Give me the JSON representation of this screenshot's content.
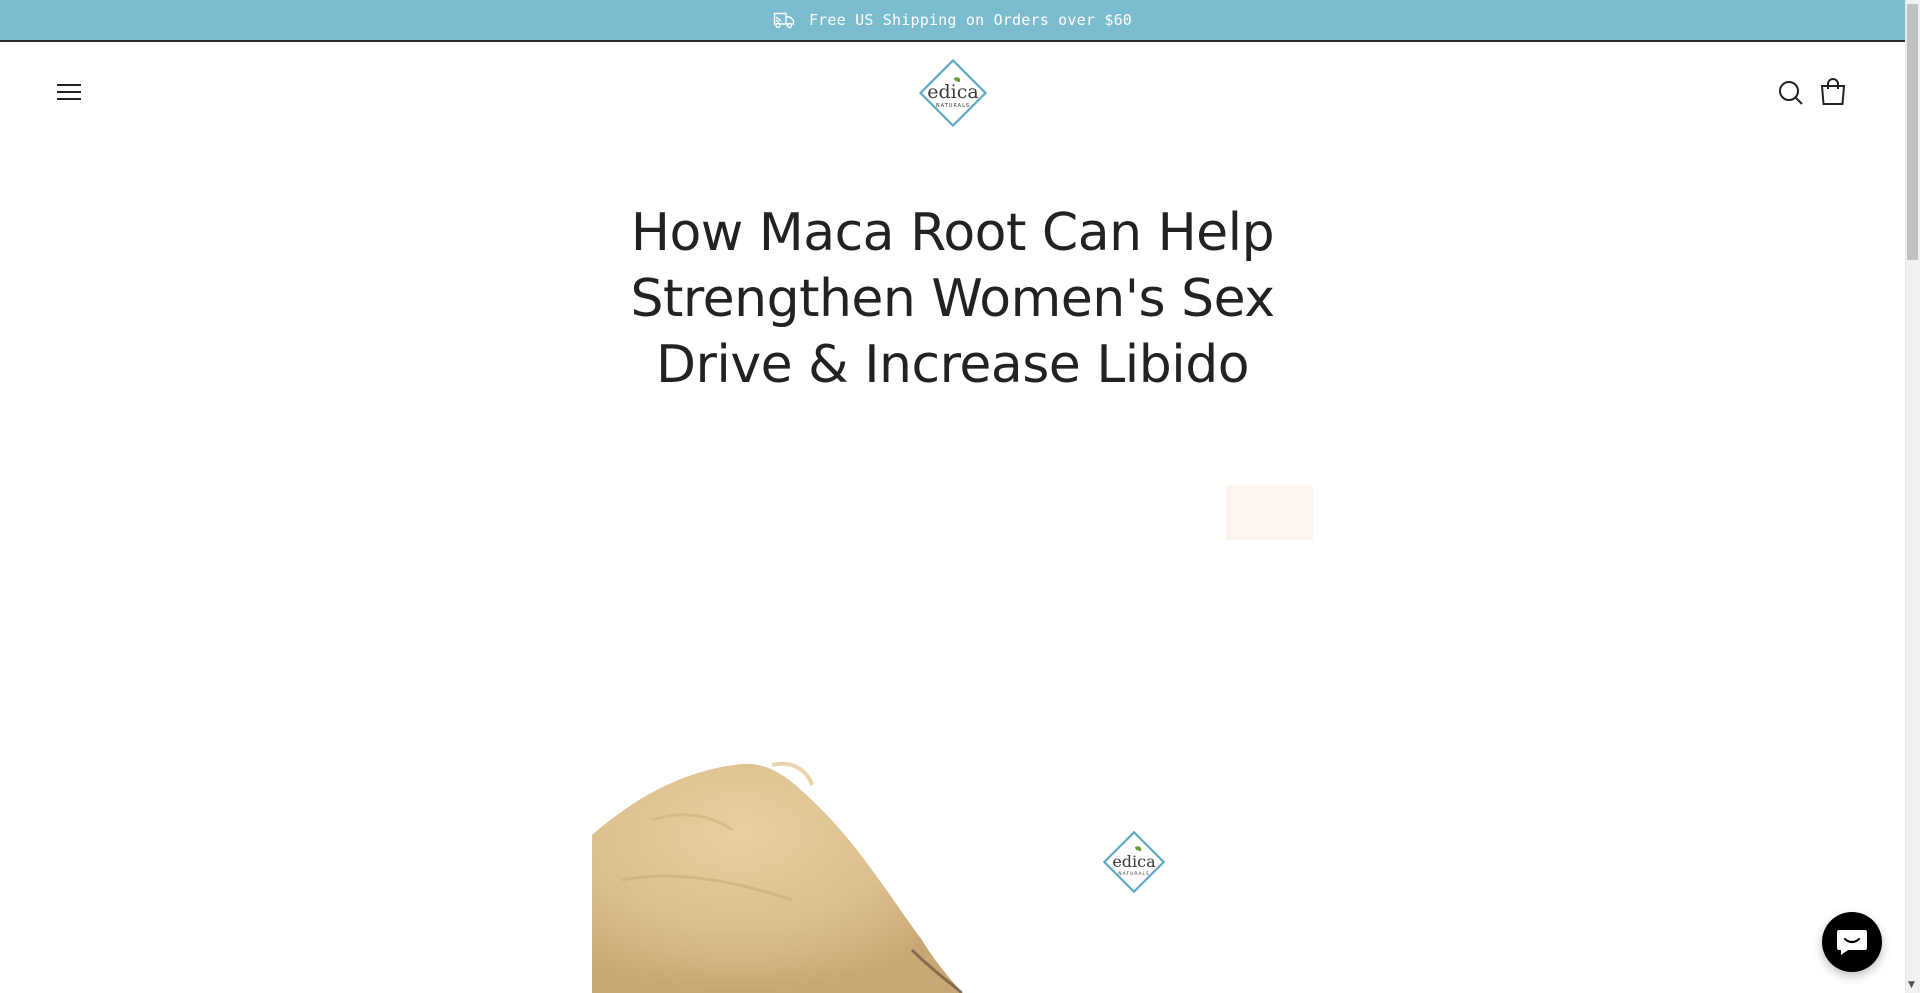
{
  "announcement": {
    "text": "Free US Shipping on Orders over $60",
    "icon": "truck-icon",
    "background": "#7cbcd0"
  },
  "header": {
    "menu_icon": "hamburger-menu-icon",
    "logo": {
      "wordmark": "edica",
      "tagline": "NATURALS",
      "border_color": "#5fa9c5",
      "leaf_color": "#6a9a3a"
    },
    "search_icon": "search-icon",
    "cart_icon": "shopping-bag-icon"
  },
  "article": {
    "title": "How Maca Root Can Help Strengthen Women's Sex Drive & Increase Libido"
  },
  "hero_image": {
    "subject": "maca powder mound with brand logo",
    "powder_color": "#dcbf8e"
  },
  "chat": {
    "icon": "chat-bubble-icon",
    "background": "#000000"
  },
  "colors": {
    "text": "#222222",
    "accent": "#7cbcd0"
  }
}
